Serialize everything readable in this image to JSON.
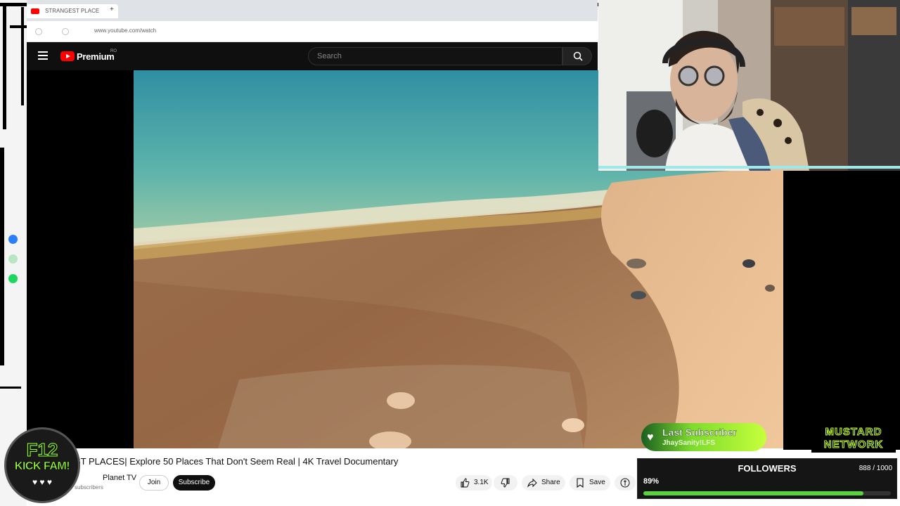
{
  "browser": {
    "tab_title": "STRANGEST PLACE",
    "new_tab_symbol": "+",
    "url": "www.youtube.com/watch"
  },
  "youtube_header": {
    "logo_text": "Premium",
    "region": "RO",
    "search_placeholder": "Search"
  },
  "video": {
    "title": "ST PLACES| Explore 50 Places That Don't Seem Real | 4K Travel Documentary",
    "channel_name": "Planet TV",
    "subscribers": "subscribers",
    "join_label": "Join",
    "subscribe_label": "Subscribe",
    "likes": "3.1K",
    "share_label": "Share",
    "save_label": "Save"
  },
  "overlays": {
    "badge_line1": "F12",
    "badge_line2": "KICK FAM!",
    "badge_hearts": "♥ ♥ ♥",
    "last_subscriber_title": "Last Subscriber",
    "last_subscriber_name": "JhaySanity!LFS",
    "network_line1": "MUSTARD",
    "network_line2": "NETWORK",
    "followers_title": "FOLLOWERS",
    "followers_count": "888 / 1000",
    "followers_pct_label": "89%",
    "followers_progress": 0.888
  },
  "colors": {
    "youtube_red": "#ff0000",
    "accent_green": "#9cff3c",
    "progress_green": "#58d43a"
  },
  "icons": [
    "youtube-logo-icon",
    "hamburger-icon",
    "search-icon",
    "like-icon",
    "dislike-icon",
    "share-icon",
    "save-icon",
    "messenger-icon",
    "whatsapp-icon",
    "spotify-icon",
    "heart-icon"
  ]
}
